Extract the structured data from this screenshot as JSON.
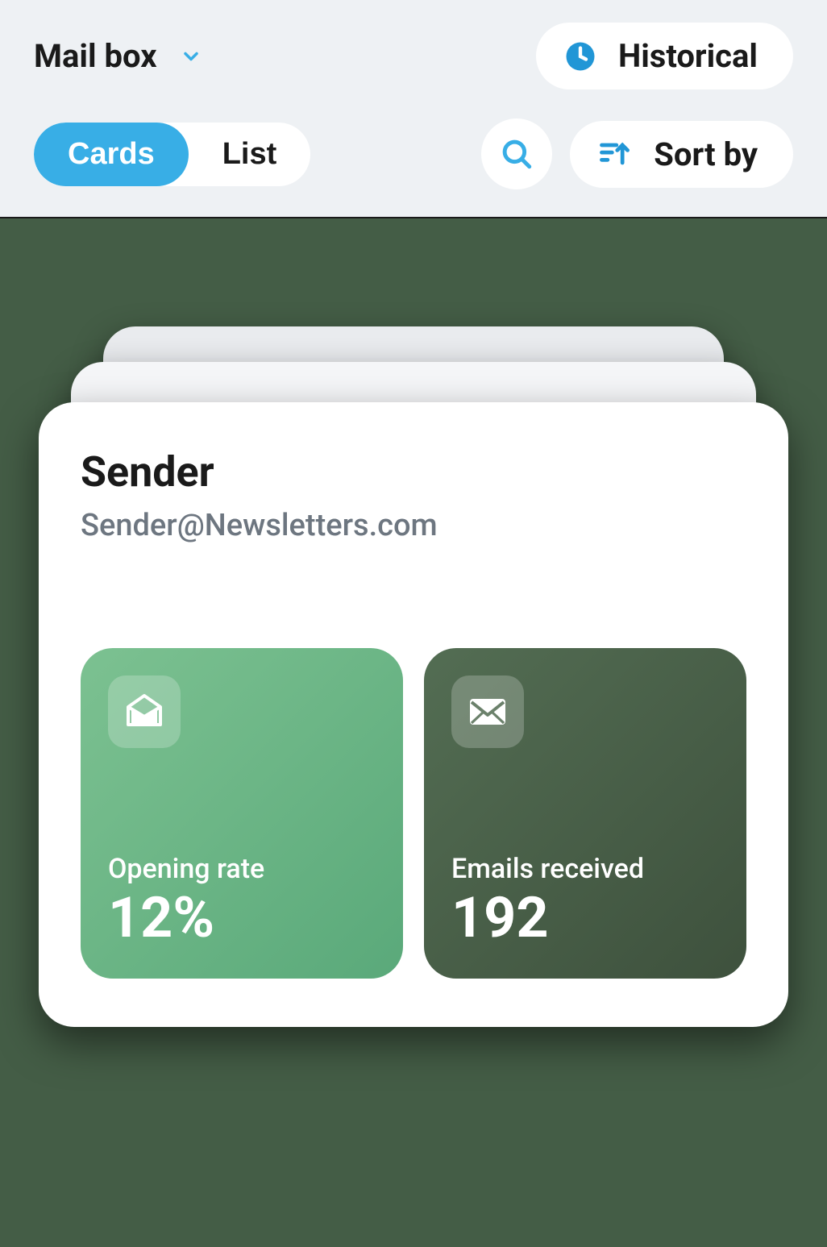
{
  "header": {
    "mailbox_label": "Mail box",
    "historical_label": "Historical"
  },
  "toolbar": {
    "cards_label": "Cards",
    "list_label": "List",
    "sort_label": "Sort by"
  },
  "card": {
    "sender_name": "Sender",
    "sender_email": "Sender@Newsletters.com",
    "stats": [
      {
        "label": "Opening rate",
        "value": "12%"
      },
      {
        "label": "Emails received",
        "value": "192"
      }
    ]
  },
  "colors": {
    "accent_blue": "#38aee6",
    "tile_light": "#6fb886",
    "tile_dark": "#4a604a"
  }
}
